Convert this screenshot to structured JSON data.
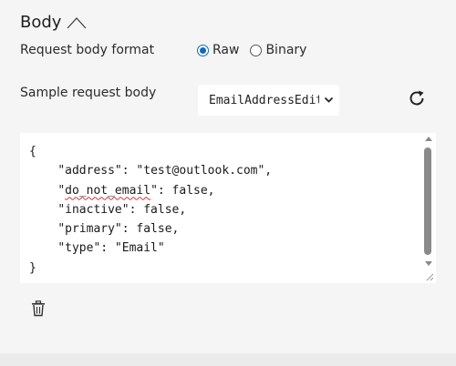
{
  "section": {
    "title": "Body"
  },
  "format": {
    "label": "Request body format",
    "options": [
      {
        "label": "Raw",
        "selected": true
      },
      {
        "label": "Binary",
        "selected": false
      }
    ]
  },
  "sample": {
    "label": "Sample request body",
    "selected_value": "EmailAddressEdit"
  },
  "editor": {
    "lines": {
      "l1": "{",
      "l2_key": "\"address\"",
      "l2_rest": ": \"test@outlook.com\",",
      "l3_quote_open": "\"",
      "l3_key": "do_not_email",
      "l3_rest": "\": false,",
      "l4": "\"inactive\": false,",
      "l5": "\"primary\": false,",
      "l6": "\"type\": \"Email\"",
      "l7": "}"
    }
  },
  "colors": {
    "accent": "#0f6cbd",
    "squiggle": "#d13438"
  },
  "icons": {
    "collapse": "chevron-up-icon",
    "dropdown": "chevron-down-icon",
    "refresh": "refresh-icon",
    "delete": "trash-icon"
  }
}
